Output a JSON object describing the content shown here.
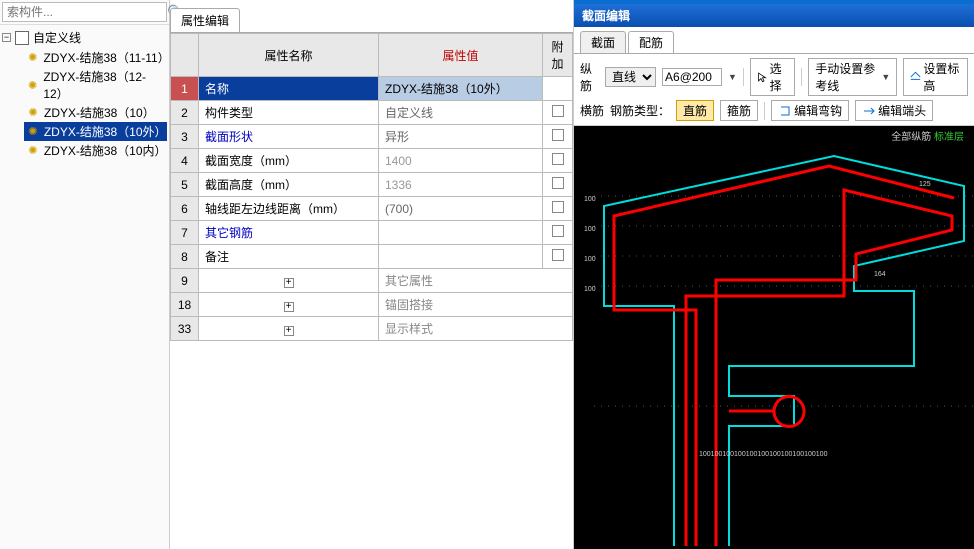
{
  "search": {
    "placeholder": "索构件..."
  },
  "tree": {
    "root_label": "自定义线",
    "items": [
      {
        "label": "ZDYX-结施38（11-11）",
        "selected": false
      },
      {
        "label": "ZDYX-结施38（12-12）",
        "selected": false
      },
      {
        "label": "ZDYX-结施38（10）",
        "selected": false
      },
      {
        "label": "ZDYX-结施38（10外）",
        "selected": true
      },
      {
        "label": "ZDYX-结施38（10内）",
        "selected": false
      }
    ]
  },
  "prop_tab": {
    "label": "属性编辑"
  },
  "prop_headers": {
    "name": "属性名称",
    "value": "属性值",
    "extra": "附加"
  },
  "props": [
    {
      "rn": "1",
      "name": "名称",
      "value": "ZDYX-结施38（10外）",
      "blue": false,
      "active": true,
      "chk": false
    },
    {
      "rn": "2",
      "name": "构件类型",
      "value": "自定义线",
      "blue": false,
      "chk": true
    },
    {
      "rn": "3",
      "name": "截面形状",
      "value": "异形",
      "blue": true,
      "chk": true
    },
    {
      "rn": "4",
      "name": "截面宽度（mm）",
      "value": "1400",
      "blue": false,
      "gray": true,
      "chk": true
    },
    {
      "rn": "5",
      "name": "截面高度（mm）",
      "value": "1336",
      "blue": false,
      "gray": true,
      "chk": true
    },
    {
      "rn": "6",
      "name": "轴线距左边线距离（mm）",
      "value": "(700)",
      "blue": false,
      "chk": true
    },
    {
      "rn": "7",
      "name": "其它钢筋",
      "value": "",
      "blue": true,
      "chk": true
    },
    {
      "rn": "8",
      "name": "备注",
      "value": "",
      "blue": false,
      "chk": true
    }
  ],
  "prop_groups": [
    {
      "rn": "9",
      "label": "其它属性"
    },
    {
      "rn": "18",
      "label": "锚固搭接"
    },
    {
      "rn": "33",
      "label": "显示样式"
    }
  ],
  "editor": {
    "title": "截面编辑",
    "tabs": {
      "jiemian": "截面",
      "peijin": "配筋"
    },
    "toolbar1": {
      "zongjin": "纵筋",
      "zhixian": "直线",
      "rebar_spec": "A6@200",
      "xuanze": "选择",
      "shoudong": "手动设置参考线",
      "shezhi": "设置标高"
    },
    "toolbar2": {
      "hengjin": "横筋",
      "gangjinlx": "钢筋类型：",
      "zhijin": "直筋",
      "gujin": "箍筋",
      "bianjiwg": "编辑弯钩",
      "bianjidt": "编辑端头"
    },
    "canvas": {
      "top_label_white": "全部纵筋",
      "top_label_green": "标准层"
    }
  }
}
